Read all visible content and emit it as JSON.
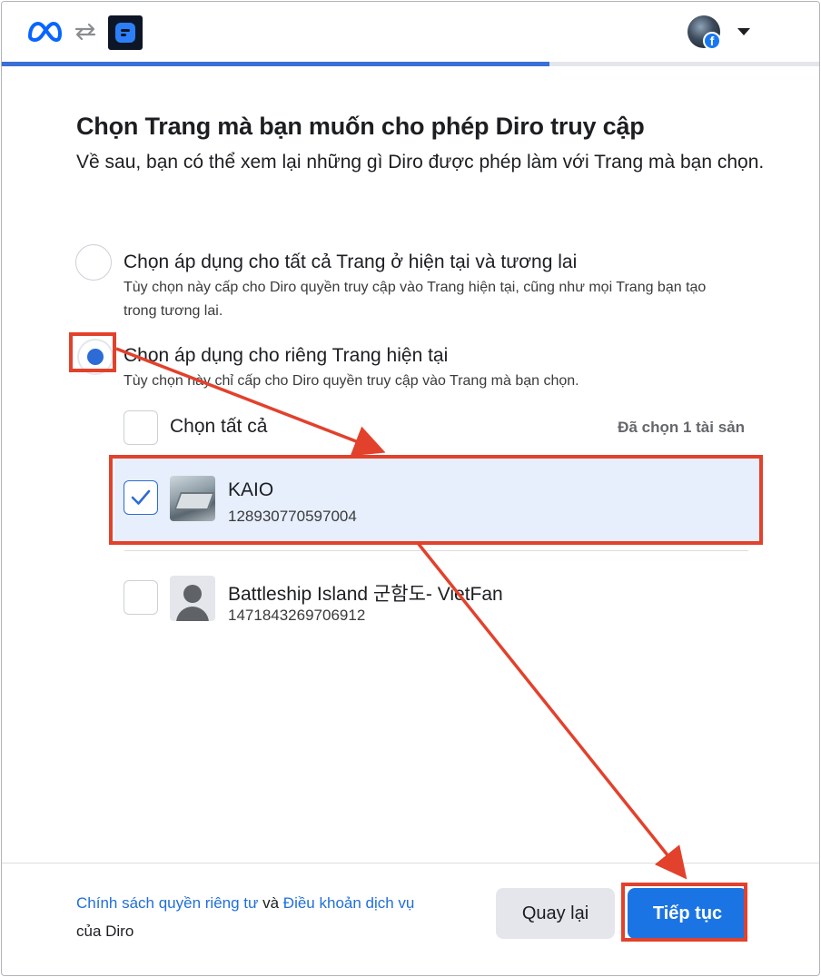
{
  "header": {
    "meta_logo_icon": "meta-logo-icon",
    "swap_icon": "swap-arrows-icon",
    "app_icon": "diro-app-icon",
    "profile_icon": "facebook-profile-avatar",
    "menu_icon": "caret-down-icon",
    "progress_percent": 67
  },
  "content": {
    "title": "Chọn Trang mà bạn muốn cho phép Diro truy cập",
    "subtitle": "Về sau, bạn có thể xem lại những gì Diro được phép làm với Trang mà bạn chọn."
  },
  "options": [
    {
      "title": "Chọn áp dụng cho tất cả Trang ở hiện tại và tương lai",
      "description": "Tùy chọn này cấp cho Diro quyền truy cập vào Trang hiện tại, cũng như mọi Trang bạn tạo trong tương lai.",
      "selected": false
    },
    {
      "title": "Chọn áp dụng cho riêng Trang hiện tại",
      "description": "Tùy chọn này chỉ cấp cho Diro quyền truy cập vào Trang mà bạn chọn.",
      "selected": true
    }
  ],
  "pages": {
    "select_all_label": "Chọn tất cả",
    "selected_count": "Đã chọn 1 tài sản",
    "items": [
      {
        "name": "KAIO",
        "id": "128930770597004",
        "checked": true,
        "thumb": "page-photo-thumbnail"
      },
      {
        "name": "Battleship Island 군함도- VietFan",
        "id": "1471843269706912",
        "checked": false,
        "thumb": "default-person-icon"
      }
    ]
  },
  "footer": {
    "privacy_link": "Chính sách quyền riêng tư",
    "and": " và ",
    "terms_link": "Điều khoản dịch vụ",
    "of_app": "của Diro",
    "back_button": "Quay lại",
    "continue_button": "Tiếp tục"
  },
  "colors": {
    "primary": "#1b74e4",
    "link": "#216fdb",
    "selected_row": "#e7effd",
    "annotation": "#e2412c"
  }
}
